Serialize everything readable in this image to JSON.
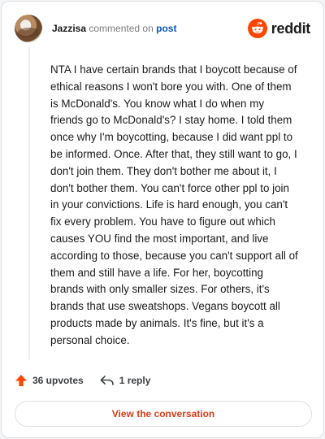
{
  "header": {
    "username": "Jazzisa",
    "action_text": "commented on",
    "post_link": "post",
    "brand_wordmark": "reddit"
  },
  "comment": {
    "body": "NTA I have certain brands that I boycott because of ethical reasons I won't bore you with. One of them is McDonald's. You know what I do when my friends go to McDonald's? I stay home. I told them once why I'm boycotting, because I did want ppl to be informed. Once. After that, they still want to go, I don't join them. They don't bother me about it, I don't bother them. You can't force other ppl to join in your convictions. Life is hard enough, you can't fix every problem. You have to figure out which causes YOU find the most important, and live according to those, because you can't support all of them and still have a life. For her, boycotting brands with only smaller sizes. For others, it's brands that use sweatshops. Vegans boycott all products made by animals. It's fine, but it's a personal choice."
  },
  "actions": {
    "upvotes": "36 upvotes",
    "replies": "1 reply"
  },
  "cta": {
    "label": "View the conversation"
  },
  "icons": {
    "avatar": "user-avatar",
    "brand": "reddit-logo-icon",
    "upvote": "upvote-arrow-icon",
    "reply": "reply-arrow-icon"
  },
  "colors": {
    "brand": "#ff4500",
    "upvote": "#ff4500",
    "link": "#0a57c2",
    "cta_text": "#d83c16"
  }
}
